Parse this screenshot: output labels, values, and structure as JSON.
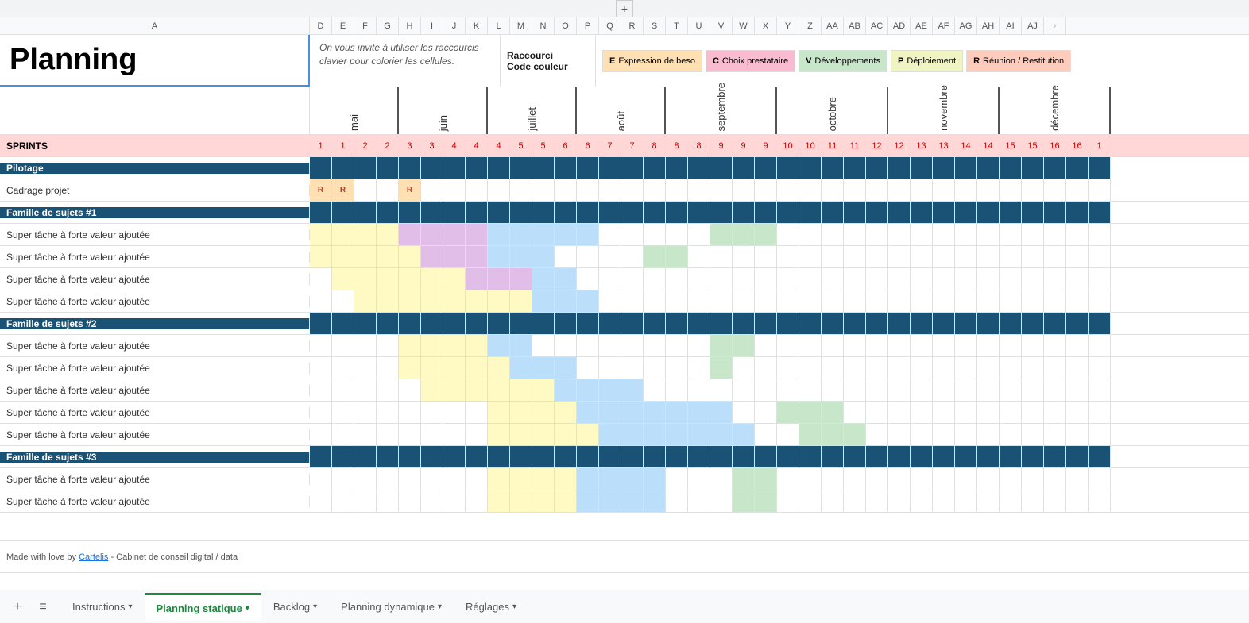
{
  "topbar": {
    "plus_icon": "+"
  },
  "col_headers": {
    "a_label": "A",
    "cols": [
      "D",
      "E",
      "F",
      "G",
      "H",
      "I",
      "J",
      "K",
      "L",
      "M",
      "N",
      "O",
      "P",
      "Q",
      "R",
      "S",
      "T",
      "U",
      "V",
      "W",
      "X",
      "Y",
      "Z",
      "AA",
      "AB",
      "AC",
      "AD",
      "AE",
      "AF",
      "AG",
      "AH",
      "AI",
      "AJ"
    ]
  },
  "title": "Planning",
  "info_text": "On vous invite à utiliser les raccourcis clavier pour colorier les cellules.",
  "raccourci": {
    "label1": "Raccourci",
    "label2": "Code couleur"
  },
  "legend": [
    {
      "key": "E",
      "label": "Expression de beso",
      "color": "#ffe0b2"
    },
    {
      "key": "C",
      "label": "Choix prestataire",
      "color": "#f8bbd0"
    },
    {
      "key": "V",
      "label": "Développements",
      "color": "#c8e6c9"
    },
    {
      "key": "P",
      "label": "Déploiement",
      "color": "#f0f4c3"
    },
    {
      "key": "R",
      "label": "Réunion / Restitution",
      "color": "#ffccbc"
    }
  ],
  "months": [
    "mai",
    "juin",
    "juillet",
    "août",
    "septembre",
    "octobre",
    "novembre",
    "décembre"
  ],
  "sprints_label": "SPRINTS",
  "sprint_numbers": [
    1,
    1,
    2,
    2,
    3,
    3,
    4,
    4,
    4,
    5,
    5,
    6,
    6,
    7,
    7,
    8,
    8,
    8,
    9,
    9,
    9,
    10,
    10,
    11,
    11,
    12,
    12,
    13,
    13,
    14,
    14,
    15,
    15,
    16,
    16,
    1
  ],
  "rows": [
    {
      "label": "Pilotage",
      "type": "header",
      "cells": []
    },
    {
      "label": "Cadrage projet",
      "type": "sub",
      "cells": [
        "r",
        "r",
        "",
        "r"
      ]
    },
    {
      "label": "Famille de sujets #1",
      "type": "header",
      "cells": []
    },
    {
      "label": "Super tâche à forte valeur ajoutée",
      "type": "sub",
      "cells": [
        "yellow",
        "yellow",
        "yellow",
        "purple",
        "purple",
        "purple",
        "blue",
        "blue"
      ]
    },
    {
      "label": "Super tâche à forte valeur ajoutée",
      "type": "sub",
      "cells": [
        "yellow",
        "yellow",
        "yellow",
        "purple",
        "purple",
        "blue",
        "blue",
        "blue"
      ]
    },
    {
      "label": "Super tâche à forte valeur ajoutée",
      "type": "sub",
      "cells": [
        "yellow",
        "yellow",
        "yellow",
        "yellow",
        "purple",
        "purple",
        "blue",
        "blue"
      ]
    },
    {
      "label": "Super tâche à forte valeur ajoutée",
      "type": "sub",
      "cells": [
        "yellow",
        "yellow",
        "yellow",
        "yellow",
        "yellow",
        "blue",
        "blue",
        "blue"
      ]
    },
    {
      "label": "Famille de sujets #2",
      "type": "header",
      "cells": []
    },
    {
      "label": "Super tâche à forte valeur ajoutée",
      "type": "sub",
      "cells": [
        "yellow",
        "yellow",
        "yellow",
        "yellow",
        "blue",
        "blue",
        "blue",
        "green",
        "green"
      ]
    },
    {
      "label": "Super tâche à forte valeur ajoutée",
      "type": "sub",
      "cells": [
        "yellow",
        "yellow",
        "yellow",
        "yellow",
        "yellow",
        "blue",
        "blue",
        "blue",
        "green"
      ]
    },
    {
      "label": "Super tâche à forte valeur ajoutée",
      "type": "sub",
      "cells": [
        "yellow",
        "yellow",
        "yellow",
        "yellow",
        "yellow",
        "yellow",
        "blue",
        "blue",
        "blue",
        "blue"
      ]
    },
    {
      "label": "Super tâche à forte valeur ajoutée",
      "type": "sub",
      "cells": [
        "yellow",
        "yellow",
        "yellow",
        "yellow",
        "yellow",
        "yellow",
        "yellow",
        "blue",
        "blue",
        "blue",
        "blue",
        "blue",
        "blue",
        "blue",
        "green",
        "green",
        "green"
      ]
    },
    {
      "label": "Super tâche à forte valeur ajoutée",
      "type": "sub",
      "cells": [
        "yellow",
        "yellow",
        "yellow",
        "yellow",
        "yellow",
        "yellow",
        "yellow",
        "yellow",
        "blue",
        "blue",
        "blue",
        "blue",
        "blue",
        "blue",
        "blue",
        "green",
        "green",
        "green"
      ]
    },
    {
      "label": "Famille de sujets #3",
      "type": "header",
      "cells": []
    },
    {
      "label": "Super tâche à forte valeur ajoutée",
      "type": "sub",
      "cells": [
        "yellow",
        "yellow",
        "yellow",
        "blue",
        "blue",
        "blue"
      ]
    },
    {
      "label": "Super tâche à forte valeur ajoutée",
      "type": "sub",
      "cells": [
        "yellow",
        "yellow",
        "yellow",
        "blue",
        "blue",
        "blue"
      ]
    }
  ],
  "footer_text": "Made with love by ",
  "footer_link_text": "Cartelis",
  "footer_suffix": " - Cabinet de conseil digital / data",
  "tabs": [
    {
      "label": "Instructions",
      "active": false,
      "color": "#555"
    },
    {
      "label": "Planning statique",
      "active": true,
      "color": "#1a8a3c"
    },
    {
      "label": "Backlog",
      "active": false,
      "color": "#555"
    },
    {
      "label": "Planning dynamique",
      "active": false,
      "color": "#555"
    },
    {
      "label": "Réglages",
      "active": false,
      "color": "#555"
    }
  ]
}
